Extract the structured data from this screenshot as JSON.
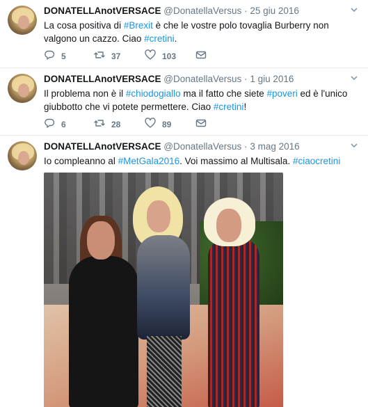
{
  "colors": {
    "accent": "#1b95e0",
    "muted": "#657786",
    "text": "#14171a",
    "divider": "#e6ecf0"
  },
  "tweets": [
    {
      "name": "DONATELLAnotVERSACE",
      "handle": "@DonatellaVersus",
      "dot": "·",
      "time": "25 giu 2016",
      "text_parts": [
        "La cosa positiva di ",
        "#Brexit",
        " è che le vostre polo tovaglia Burberry non valgono un cazzo. Ciao ",
        "#cretini",
        "."
      ],
      "replies": "5",
      "retweets": "37",
      "likes": "103"
    },
    {
      "name": "DONATELLAnotVERSACE",
      "handle": "@DonatellaVersus",
      "dot": "·",
      "time": "1 giu 2016",
      "text_parts": [
        "Il problema non è il ",
        "#chiodogiallo",
        " ma il fatto che siete ",
        "#poveri",
        " ed è l'unico giubbotto che vi potete permettere. Ciao ",
        "#cretini",
        "!"
      ],
      "replies": "6",
      "retweets": "28",
      "likes": "89"
    },
    {
      "name": "DONATELLAnotVERSACE",
      "handle": "@DonatellaVersus",
      "dot": "·",
      "time": "3 mag 2016",
      "text_parts": [
        "Io compleanno al ",
        "#MetGala2016",
        ". Voi massimo al Multisala. ",
        "#ciaocretini"
      ]
    }
  ]
}
